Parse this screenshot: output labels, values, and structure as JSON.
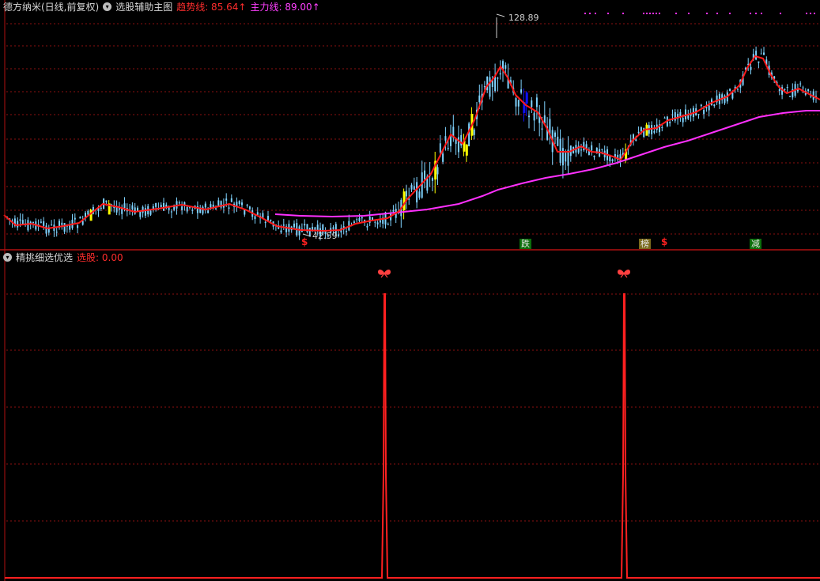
{
  "top_panel": {
    "stock_title": "德方纳米(日线,前复权)",
    "indicator_name": "选股辅助主图",
    "trend_label": "趋势线: 85.64↑",
    "main_label": "主力线: 89.00↑",
    "high_price": "128.89",
    "low_price": "42.59",
    "signal_labels": [
      "$",
      "跌",
      "榜",
      "$",
      "减"
    ]
  },
  "bottom_panel": {
    "indicator_name": "精挑细选优选",
    "select_label": "选股: 0.00"
  },
  "colors": {
    "trend_line": "#ff1a1a",
    "main_line": "#ff30ff",
    "grid": "#8b1010",
    "candle": "#7fd3ff",
    "candle_yellow": "#ffff00",
    "candle_blue": "#1010ff"
  },
  "icons": [
    "butterfly-icon",
    "dropdown-icon"
  ],
  "chart_data": [
    {
      "type": "line",
      "title": "选股辅助主图",
      "series": [
        {
          "name": "趋势线",
          "last_value": 85.64
        },
        {
          "name": "主力线",
          "last_value": 89.0
        }
      ],
      "annotations": {
        "high": 128.89,
        "low": 42.59
      }
    },
    {
      "type": "line",
      "title": "精挑细选优选",
      "series": [
        {
          "name": "选股",
          "last_value": 0.0
        }
      ]
    }
  ]
}
